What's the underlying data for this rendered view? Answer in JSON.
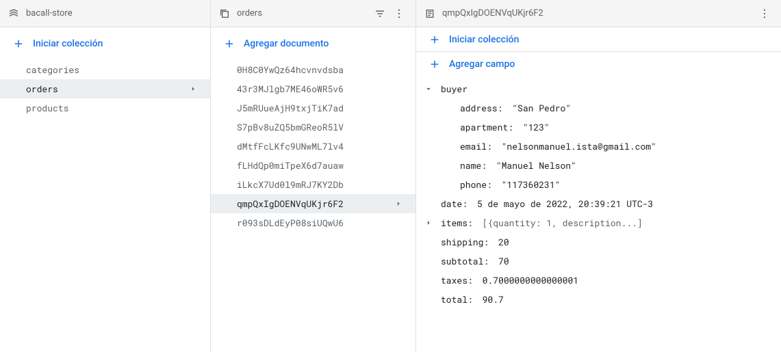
{
  "panel1": {
    "title": "bacall-store",
    "add_label": "Iniciar colección",
    "collections": [
      {
        "name": "categories",
        "selected": false
      },
      {
        "name": "orders",
        "selected": true
      },
      {
        "name": "products",
        "selected": false
      }
    ]
  },
  "panel2": {
    "title": "orders",
    "add_label": "Agregar documento",
    "documents": [
      {
        "id": "0H8C0YwQz64hcvnvdsba",
        "selected": false
      },
      {
        "id": "43r3MJlgb7ME46oWR5v6",
        "selected": false
      },
      {
        "id": "J5mRUueAjH9txjTiK7ad",
        "selected": false
      },
      {
        "id": "S7pBv8uZQ5bmGReoR5lV",
        "selected": false
      },
      {
        "id": "dMtfFcLKfc9UNwML7lv4",
        "selected": false
      },
      {
        "id": "fLHdQp0miTpeX6d7auaw",
        "selected": false
      },
      {
        "id": "iLkcX7Ud0l9mRJ7KY2Db",
        "selected": false
      },
      {
        "id": "qmpQxIgDOENVqUKjr6F2",
        "selected": true
      },
      {
        "id": "r093sDLdEyP08siUQwU6",
        "selected": false
      }
    ]
  },
  "panel3": {
    "title": "qmpQxIgDOENVqUKjr6F2",
    "start_collection_label": "Iniciar colección",
    "add_field_label": "Agregar campo",
    "buyer_key": "buyer",
    "buyer_address_key": "address:",
    "buyer_address_val": "\"San Pedro\"",
    "buyer_apartment_key": "apartment:",
    "buyer_apartment_val": "\"123\"",
    "buyer_email_key": "email:",
    "buyer_email_val": "\"nelsonmanuel.ista@gmail.com\"",
    "buyer_name_key": "name:",
    "buyer_name_val": "\"Manuel Nelson\"",
    "buyer_phone_key": "phone:",
    "buyer_phone_val": "\"117360231\"",
    "date_key": "date:",
    "date_val": "5 de mayo de 2022, 20:39:21 UTC-3",
    "items_key": "items:",
    "items_val": "[{quantity: 1, description...]",
    "shipping_key": "shipping:",
    "shipping_val": "20",
    "subtotal_key": "subtotal:",
    "subtotal_val": "70",
    "taxes_key": "taxes:",
    "taxes_val": "0.7000000000000001",
    "total_key": "total:",
    "total_val": "90.7"
  }
}
